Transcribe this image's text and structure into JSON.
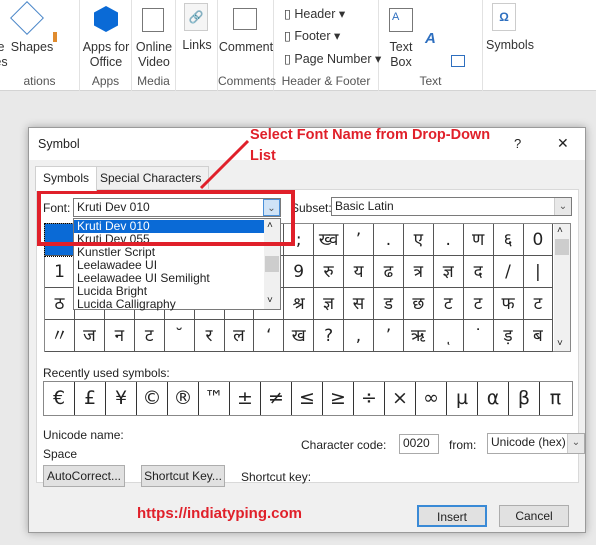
{
  "ribbon": {
    "groups": [
      {
        "label": "ations"
      },
      {
        "label": "Apps"
      },
      {
        "label": "Media"
      },
      {
        "label": ""
      },
      {
        "label": "Comments"
      },
      {
        "label": "Header & Footer"
      },
      {
        "label": "Text"
      }
    ],
    "partial_left": "e\nes",
    "shapes": "Shapes",
    "apps_for_office": "Apps for Office",
    "online_video": "Online Video",
    "links": "Links",
    "comment": "Comment",
    "header": "Header",
    "footer": "Footer",
    "page_number": "Page Number",
    "text_box": "Text Box",
    "symbols": "Symbols"
  },
  "dialog": {
    "title": "Symbol",
    "help": "?",
    "close": "✕",
    "tabs": [
      "Symbols",
      "Special Characters"
    ],
    "font_label": "Font:",
    "font_value": "Kruti Dev 010",
    "subset_label": "Subset:",
    "subset_value": "Basic Latin",
    "font_options": [
      "Kruti Dev 010",
      "Kruti Dev 055",
      "Kunstler Script",
      "Leelawadee UI",
      "Leelawadee UI Semilight",
      "Lucida Bright",
      "Lucida Calligraphy"
    ],
    "selected_font_index": 0,
    "grid": [
      [
        " ",
        "",
        "",
        "",
        "",
        "",
        "",
        "",
        ";",
        "ख्व",
        "’",
        ".",
        "ए",
        ".",
        "ण",
        "६",
        "0"
      ],
      [
        "1",
        "",
        "",
        "",
        "",
        "",
        "",
        "",
        "9",
        "रु",
        "य",
        "ढ",
        "त्र",
        "ज्ञ",
        "द",
        "/",
        "|"
      ],
      [
        "ठ",
        "",
        "",
        "",
        "",
        "",
        "",
        "",
        "श्र",
        "ज्ञ",
        "स",
        "ड",
        "छ",
        "ट",
        "ट",
        "फ",
        "ट"
      ],
      [
        "〃",
        "ज",
        "न",
        "ट",
        "˘",
        "र",
        "ल",
        "ʻ",
        "ख",
        "?",
        ",",
        "’",
        "ऋ",
        "ͺ",
        "˙",
        "ड़",
        "ब"
      ]
    ],
    "recent_label": "Recently used symbols:",
    "recent": [
      "€",
      "£",
      "¥",
      "©",
      "®",
      "™",
      "±",
      "≠",
      "≤",
      "≥",
      "÷",
      "×",
      "∞",
      "µ",
      "α",
      "β",
      "π"
    ],
    "unicode_name_label": "Unicode name:",
    "unicode_name": "Space",
    "char_code_label": "Character code:",
    "char_code": "0020",
    "from_label": "from:",
    "from_value": "Unicode (hex)",
    "autocorrect": "AutoCorrect...",
    "shortcut_key_btn": "Shortcut Key...",
    "shortcut_key_label": "Shortcut key:",
    "insert": "Insert",
    "cancel": "Cancel"
  },
  "annotation": {
    "callout": "Select Font Name from Drop-Down List",
    "url": "https://indiatyping.com",
    "color": "#e0202a"
  }
}
